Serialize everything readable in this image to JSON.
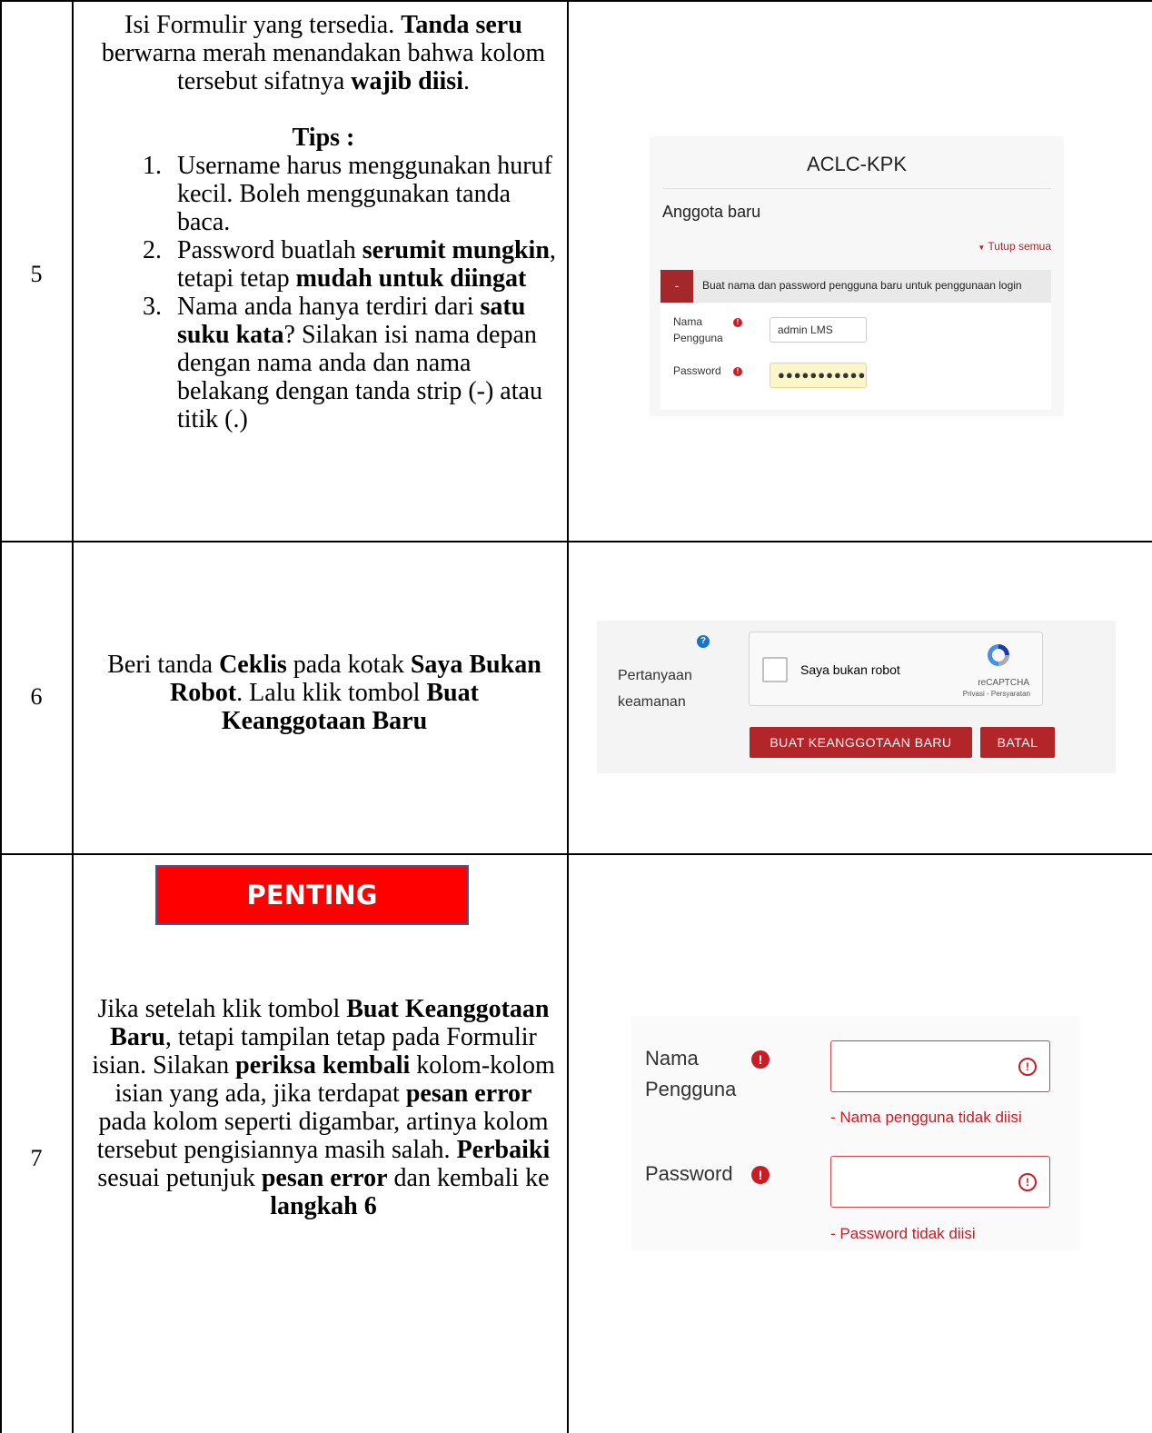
{
  "rows": [
    {
      "number": "5",
      "intro": {
        "p1": "Isi Formulir yang tersedia. ",
        "b1": "Tanda seru",
        "p2": " berwarna merah menandakan bahwa kolom tersebut sifatnya ",
        "b2": "wajib diisi",
        "p3": "."
      },
      "tips_title": "Tips :",
      "tips": [
        {
          "text": "Username harus menggunakan huruf kecil. Boleh menggunakan tanda baca."
        },
        {
          "p1": "Password buatlah ",
          "b1": "serumit mungkin",
          "p2": ", tetapi tetap ",
          "b2": "mudah untuk diingat"
        },
        {
          "p1": "Nama anda hanya terdiri dari ",
          "b1": "satu suku kata",
          "p2": "? Silakan isi nama depan dengan nama anda dan nama belakang dengan tanda strip (-) atau titik (.)"
        }
      ]
    },
    {
      "number": "6",
      "p1": "Beri tanda ",
      "b1": "Ceklis",
      "p2": " pada kotak ",
      "b2": "Saya Bukan Robot",
      "p3": ". Lalu klik tombol ",
      "b3": "Buat Keanggotaan Baru"
    },
    {
      "number": "7",
      "banner": "PENTING",
      "p1": "Jika setelah klik tombol ",
      "b1": "Buat Keanggotaan Baru",
      "p2": ", tetapi tampilan tetap pada Formulir isian. Silakan ",
      "b2": "periksa kembali",
      "p3": " kolom-kolom isian yang ada, jika terdapat ",
      "b3": "pesan error",
      "p4": " pada kolom seperti digambar, artinya kolom tersebut pengisiannya masih salah. ",
      "b4": "Perbaiki",
      "p5": " sesuai petunjuk ",
      "b5": "pesan error",
      "p6": " dan kembali ke ",
      "b6": "langkah 6"
    }
  ],
  "screenshot_signup": {
    "site_name": "ACLC-KPK",
    "heading": "Anggota baru",
    "collapse_all": "Tutup semua",
    "section_toggle": "-",
    "section_title": "Buat nama dan password pengguna baru untuk penggunaan login",
    "username_label_1": "Nama",
    "username_label_2": "Pengguna",
    "username_value": "admin LMS",
    "password_label": "Password",
    "password_value": "●●●●●●●●●●●",
    "required_icon": "!"
  },
  "screenshot_captcha": {
    "help_icon": "?",
    "label_1": "Pertanyaan",
    "label_2": "keamanan",
    "checkbox_label": "Saya bukan robot",
    "recaptcha_name": "reCAPTCHA",
    "recaptcha_links": "Privasi - Persyaratan",
    "submit_button": "BUAT KEANGGOTAAN BARU",
    "cancel_button": "BATAL"
  },
  "screenshot_errors": {
    "username_label_1": "Nama",
    "username_label_2": "Pengguna",
    "username_error": "- Nama pengguna tidak diisi",
    "password_label": "Password",
    "password_error": "- Password tidak diisi",
    "required_icon": "!",
    "warning_icon": "!"
  },
  "colors": {
    "moodle_red": "#b22528",
    "error_red": "#ca1c25",
    "banner_red": "#ff0000",
    "banner_border": "#3d5a96",
    "recaptcha_blue": "#1a73c6"
  }
}
